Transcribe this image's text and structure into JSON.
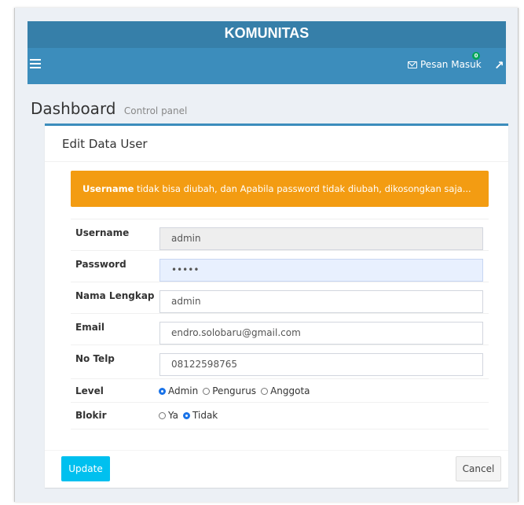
{
  "header": {
    "brand": "KOMUNITAS",
    "messages_label": "Pesan Masuk",
    "messages_count": "0",
    "colors": {
      "brand_bar": "#367fa9",
      "nav_bar": "#3c8dbc",
      "badge": "#00a65a"
    }
  },
  "page": {
    "title": "Dashboard",
    "subtitle": "Control panel"
  },
  "form": {
    "title": "Edit Data User",
    "alert": {
      "bold": "Username",
      "text": " tidak bisa diubah, dan Apabila password tidak diubah, dikosongkan saja...",
      "color": "#f39c12"
    },
    "fields": {
      "username": {
        "label": "Username",
        "value": "admin",
        "disabled": true
      },
      "password": {
        "label": "Password",
        "value": "•••••"
      },
      "nama": {
        "label": "Nama Lengkap",
        "value": "admin"
      },
      "email": {
        "label": "Email",
        "value": "endro.solobaru@gmail.com"
      },
      "telp": {
        "label": "No Telp",
        "value": "08122598765"
      }
    },
    "level": {
      "label": "Level",
      "options": [
        "Admin",
        "Pengurus",
        "Anggota"
      ],
      "selected": "Admin"
    },
    "blokir": {
      "label": "Blokir",
      "options": [
        "Ya",
        "Tidak"
      ],
      "selected": "Tidak"
    },
    "buttons": {
      "update": "Update",
      "cancel": "Cancel"
    },
    "colors": {
      "update_button": "#00c0ef",
      "radio_selected": "#1a73e8"
    }
  }
}
